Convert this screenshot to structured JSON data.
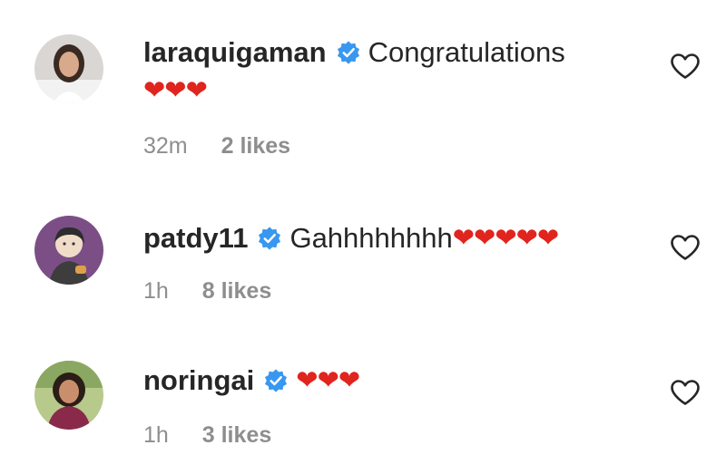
{
  "comments": [
    {
      "username": "laraquigaman",
      "verified": true,
      "text": "Congratulations",
      "hearts": "❤❤❤",
      "time": "32m",
      "likes": "2 likes",
      "avatar_icon": "profile-photo-woman"
    },
    {
      "username": "patdy11",
      "verified": true,
      "text": "Gahhhhhhhh",
      "hearts": "❤❤❤❤❤",
      "time": "1h",
      "likes": "8 likes",
      "avatar_icon": "profile-cartoon-avatar"
    },
    {
      "username": "noringai",
      "verified": true,
      "text": "",
      "hearts": "❤❤❤",
      "time": "1h",
      "likes": "3 likes",
      "avatar_icon": "profile-photo-woman"
    }
  ],
  "colors": {
    "verified_blue": "#3897f0",
    "meta_gray": "#8e8e8e",
    "heart_red": "#e0241e",
    "text_dark": "#262626"
  },
  "icons": {
    "verified": "verified-badge-icon",
    "like": "heart-outline-icon"
  }
}
